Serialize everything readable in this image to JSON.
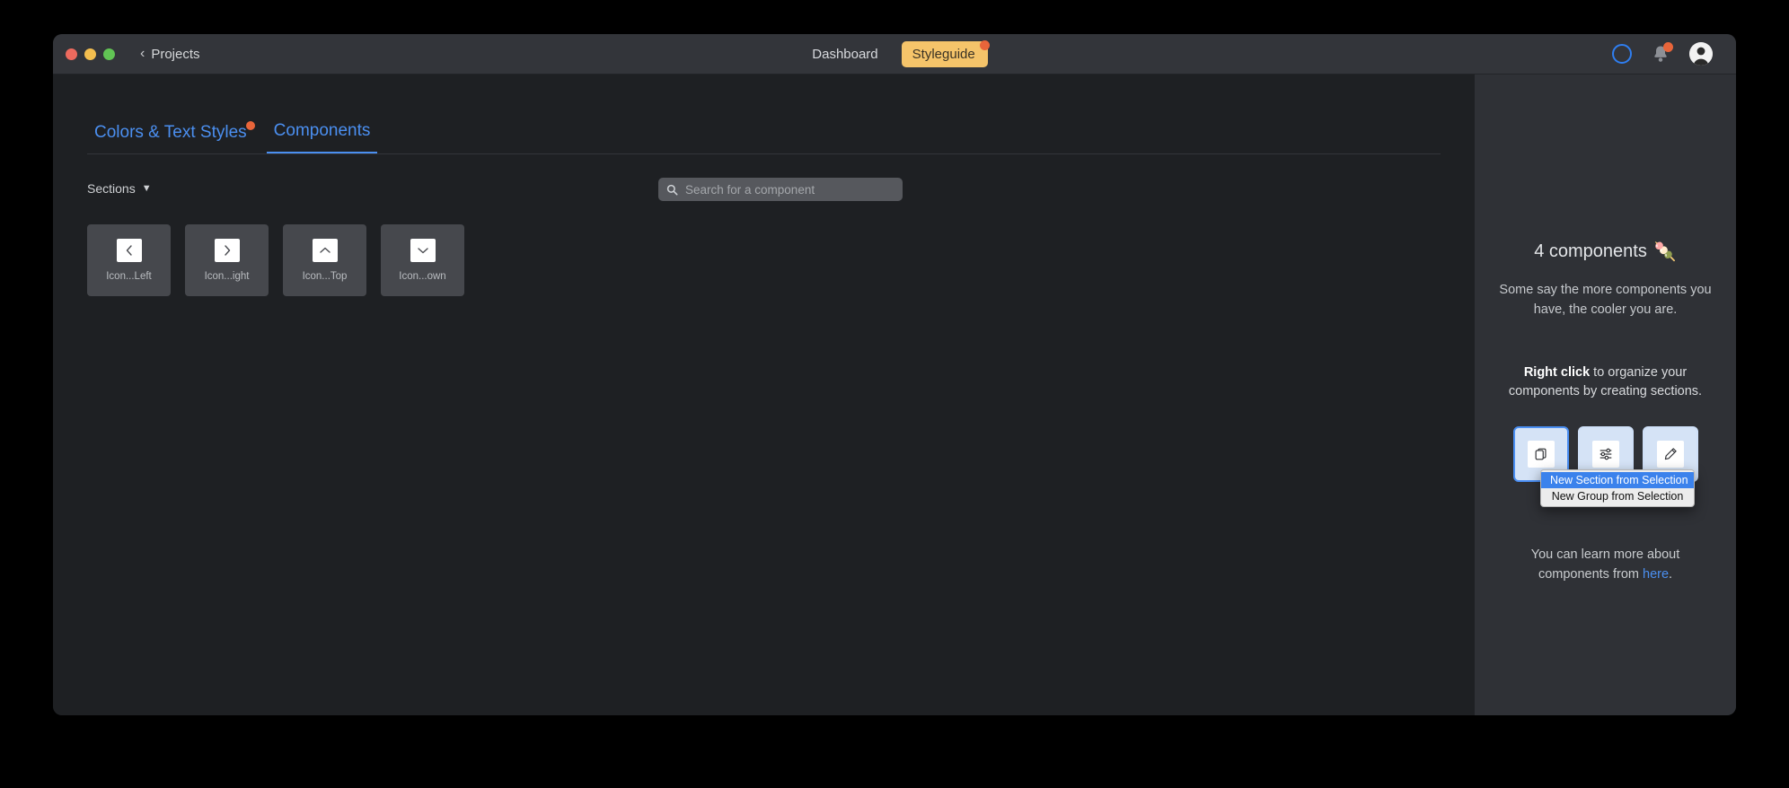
{
  "window": {
    "back_label": "Projects",
    "back_icon": "chevron-left-icon",
    "traffic": {
      "close": "close-button",
      "minimize": "minimize-button",
      "maximize": "maximize-button"
    }
  },
  "nav": {
    "tabs": [
      {
        "label": "Dashboard",
        "active": false,
        "badge": false
      },
      {
        "label": "Styleguide",
        "active": true,
        "badge": true
      }
    ],
    "right_icons": [
      {
        "name": "sync-ring-icon"
      },
      {
        "name": "notification-bell-icon",
        "badge": true
      },
      {
        "name": "user-avatar"
      }
    ]
  },
  "section_tabs": [
    {
      "label": "Colors & Text Styles",
      "active": false,
      "badge": true
    },
    {
      "label": "Components",
      "active": true,
      "badge": false
    }
  ],
  "controls": {
    "sections_label": "Sections",
    "sections_icon": "chevron-down-icon",
    "search": {
      "placeholder": "Search for a component",
      "value": "",
      "icon": "search-icon"
    }
  },
  "components": {
    "items": [
      {
        "label": "Icon...Left",
        "icon": "chevron-left-icon"
      },
      {
        "label": "Icon...ight",
        "icon": "chevron-right-icon"
      },
      {
        "label": "Icon...Top",
        "icon": "chevron-up-icon"
      },
      {
        "label": "Icon...own",
        "icon": "chevron-down-icon"
      }
    ]
  },
  "side_panel": {
    "count_title": "4 components",
    "count_emoji": "🍡",
    "subtitle": "Some say the more components you have, the cooler you are.",
    "hint_strong": "Right click",
    "hint_rest": " to organize your components by creating sections.",
    "action_buttons": [
      {
        "name": "duplicate-button",
        "icon": "copy-icon"
      },
      {
        "name": "settings-button",
        "icon": "sliders-icon"
      },
      {
        "name": "rename-button",
        "icon": "pencil-icon"
      }
    ],
    "context_menu": {
      "items": [
        {
          "label": "New Section from Selection",
          "selected": true
        },
        {
          "label": "New Group from Selection",
          "selected": false
        }
      ]
    },
    "footer_prefix": "You can learn more about components from ",
    "footer_link": "here",
    "footer_suffix": "."
  },
  "colors": {
    "accent_blue": "#4b8ff0",
    "badge_orange": "#e8653a",
    "tab_yellow": "#f5c46a",
    "panel_bg": "#2f3136",
    "main_bg": "#1e2023",
    "titlebar_bg": "#33353a",
    "menu_highlight": "#3b82ec"
  }
}
